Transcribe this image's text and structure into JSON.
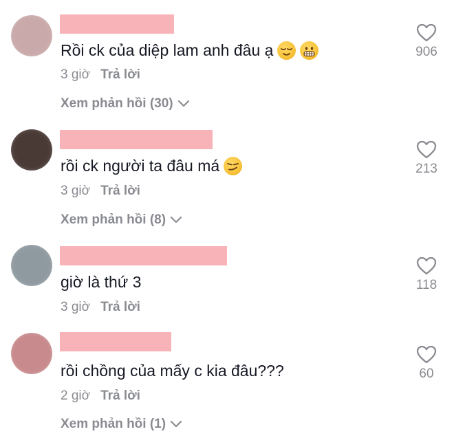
{
  "comments": [
    {
      "text": "Rồi ck của diệp lam anh đâu ạ",
      "emojis": [
        "relieved-face-emoji",
        "grimacing-face-emoji"
      ],
      "time": "3 giờ",
      "reply_label": "Trả lời",
      "view_replies": "Xem phản hồi (30)",
      "likes": "906",
      "avatar_color": "#c9a9a9"
    },
    {
      "text": "rồi ck người ta đâu má",
      "emojis": [
        "smirking-face-emoji"
      ],
      "time": "3 giờ",
      "reply_label": "Trả lời",
      "view_replies": "Xem phản hồi (8)",
      "likes": "213",
      "avatar_color": "#4a3a36"
    },
    {
      "text": "giờ là thứ 3",
      "emojis": [],
      "time": "3 giờ",
      "reply_label": "Trả lời",
      "view_replies": "",
      "likes": "118",
      "avatar_color": "#8f9aa0"
    },
    {
      "text": "rồi chồng của mấy c kia đâu???",
      "emojis": [],
      "time": "2 giờ",
      "reply_label": "Trả lời",
      "view_replies": "Xem phản hồi (1)",
      "likes": "60",
      "avatar_color": "#c88a8c"
    }
  ],
  "colors": {
    "redaction": "#f7b3b8",
    "text": "#161823",
    "muted": "#8a8b91"
  },
  "icons": {
    "like": "heart-outline-icon",
    "expand": "chevron-down-icon"
  }
}
